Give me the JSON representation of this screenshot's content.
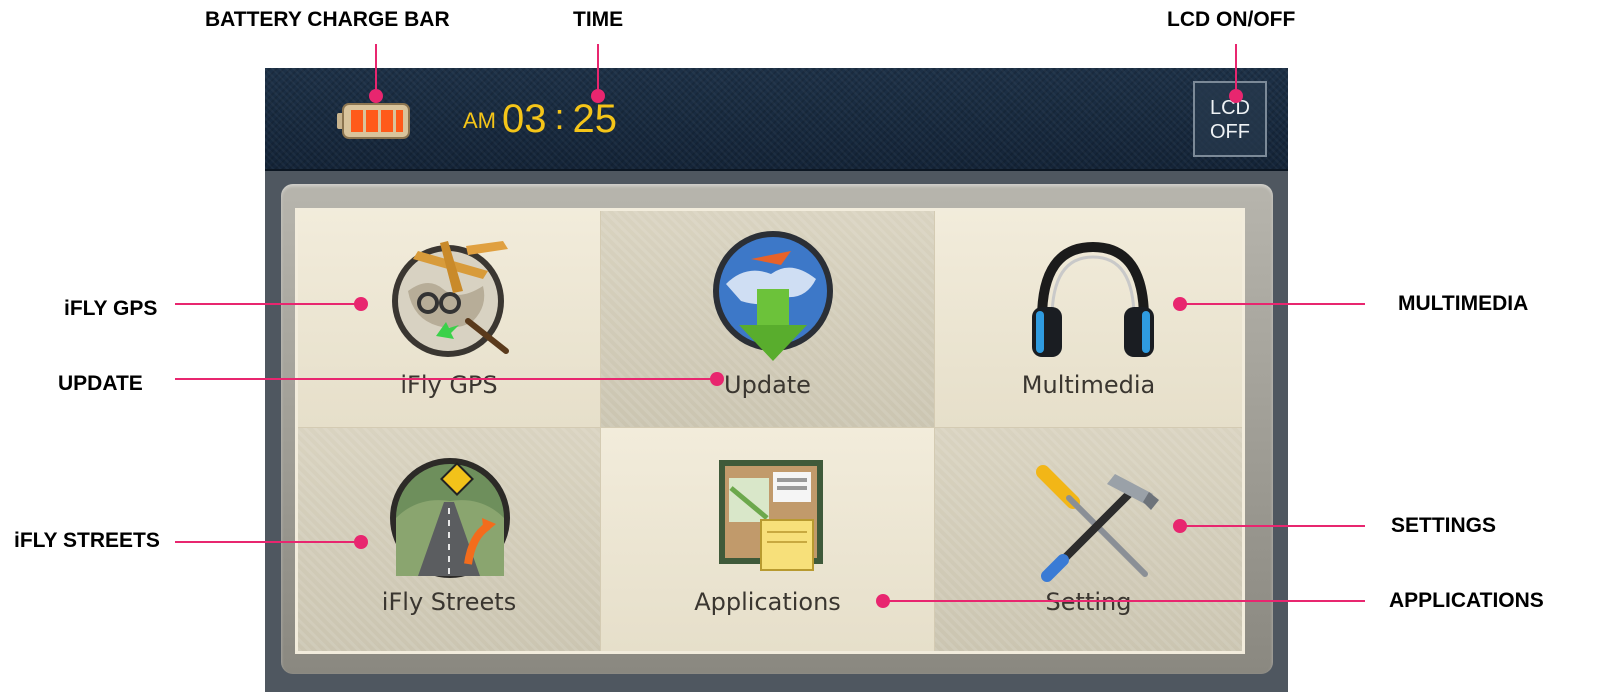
{
  "callouts": {
    "battery": "BATTERY CHARGE BAR",
    "time": "TIME",
    "lcd": "LCD ON/OFF",
    "ifly_gps": "iFLY GPS",
    "update": "UPDATE",
    "multimedia": "MULTIMEDIA",
    "ifly_streets": "iFLY STREETS",
    "settings": "SETTINGS",
    "applications": "APPLICATIONS"
  },
  "statusbar": {
    "ampm": "AM",
    "hours": "03",
    "separator": ":",
    "minutes": "25",
    "battery_level_fraction": 1.0,
    "lcd_line1": "LCD",
    "lcd_line2": "OFF"
  },
  "menu": {
    "ifly_gps": "iFly GPS",
    "update": "Update",
    "multimedia": "Multimedia",
    "ifly_streets": "iFly Streets",
    "applications": "Applications",
    "setting": "Setting"
  },
  "colors": {
    "callout_accent": "#e8266f",
    "clock": "#f5c518",
    "topbar": "#1d3147"
  },
  "icons": {
    "ifly_gps": "globe-airplane-icon",
    "update": "globe-download-arrow-icon",
    "multimedia": "headphones-icon",
    "ifly_streets": "road-sign-icon",
    "applications": "corkboard-memo-icon",
    "setting": "screwdriver-hammer-icon"
  }
}
